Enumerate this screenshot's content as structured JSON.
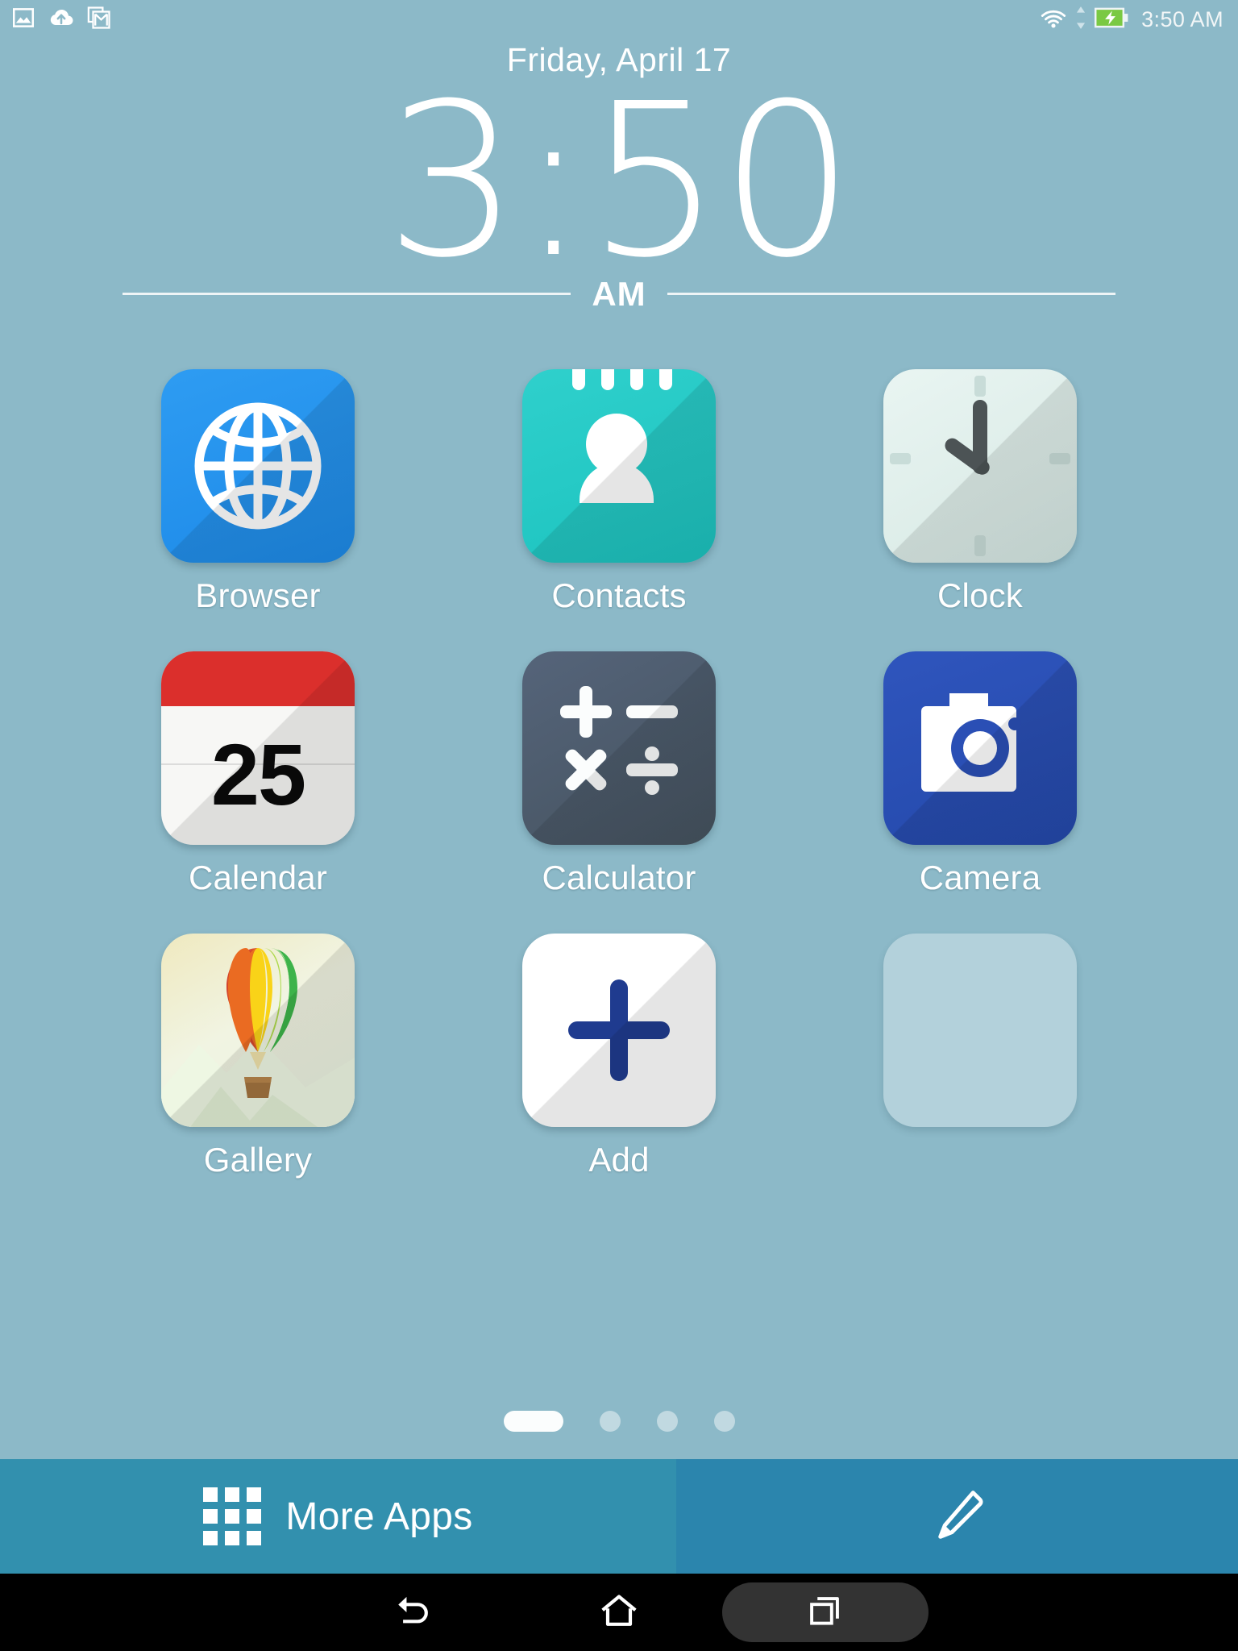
{
  "status_bar": {
    "notification_icons": [
      "screenshot-image-icon",
      "cloud-upload-icon",
      "gmail-icon"
    ],
    "wifi_icon": "wifi-icon",
    "data_arrows_icon": "data-transfer-arrows-icon",
    "battery_icon": "battery-charging-icon",
    "clock": "3:50 AM",
    "battery_color": "#7ac943"
  },
  "clock_widget": {
    "date": "Friday, April 17",
    "hour": "3",
    "separator": ":",
    "minute": "50",
    "meridiem": "AM"
  },
  "apps": [
    {
      "label": "Browser",
      "icon": "globe-icon"
    },
    {
      "label": "Contacts",
      "icon": "person-icon"
    },
    {
      "label": "Clock",
      "icon": "analog-clock-icon"
    },
    {
      "label": "Calendar",
      "icon": "calendar-icon",
      "day": "25"
    },
    {
      "label": "Calculator",
      "icon": "calculator-icon",
      "symbols": [
        "+",
        "−",
        "×",
        "÷"
      ]
    },
    {
      "label": "Camera",
      "icon": "camera-icon"
    },
    {
      "label": "Gallery",
      "icon": "hot-air-balloon-icon"
    },
    {
      "label": "Add",
      "icon": "plus-icon"
    },
    {
      "label": "",
      "icon": "empty-slot"
    }
  ],
  "page_indicator": {
    "total": 4,
    "active_index": 0
  },
  "dock": {
    "more_apps_label": "More Apps",
    "more_apps_icon": "app-grid-icon",
    "edit_icon": "pencil-edit-icon"
  },
  "nav_bar": {
    "back_icon": "back-arrow-icon",
    "home_icon": "home-icon",
    "recents_icon": "recent-apps-icon"
  },
  "colors": {
    "wallpaper": "#8cb9c8",
    "dock_primary": "#3290ae",
    "dock_secondary": "#2b85ad",
    "browser": "#2e9cf2",
    "contacts": "#2fd0cc",
    "clock": "#e4f1ed",
    "calendar_header": "#db2f2c",
    "calculator": "#4e5c6e",
    "camera": "#2a4fb5",
    "add_plus": "#1f3b8f",
    "nav_bar": "#000000"
  }
}
